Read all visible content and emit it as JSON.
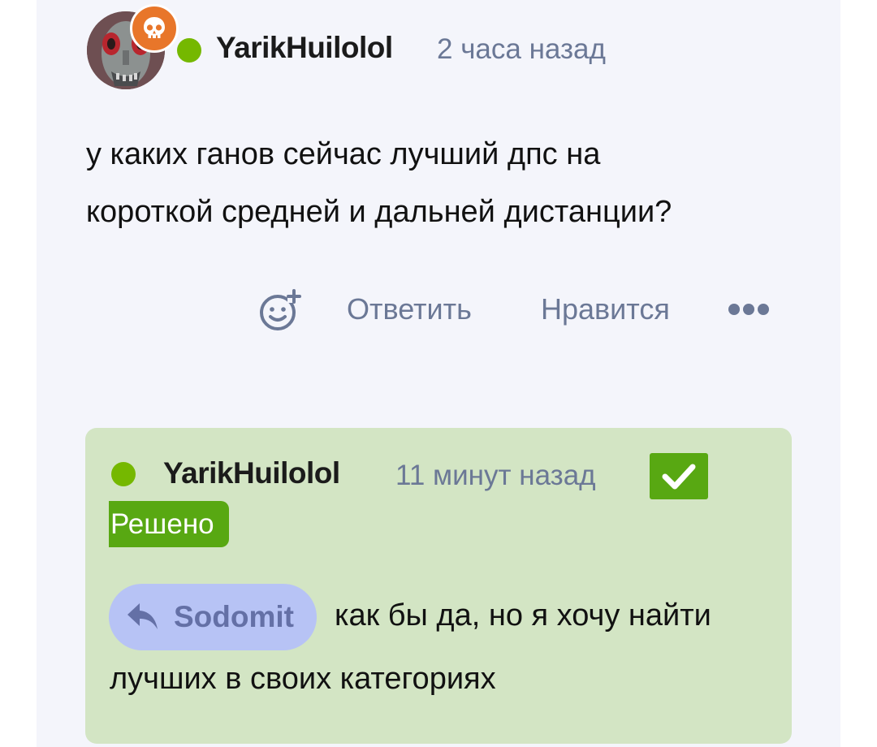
{
  "comment": {
    "author": "YarikHuilolol",
    "time": "2 часа назад",
    "text_line1": "у каких ганов сейчас лучший дпс на",
    "text_line2": "короткой средней и дальней дистанции?",
    "actions": {
      "reply_label": "Ответить",
      "like_label": "Нравится"
    },
    "icons": {
      "badge": "skull-icon",
      "react": "add-reaction-icon",
      "more": "more-dots-icon"
    }
  },
  "reply": {
    "author": "YarikHuilolol",
    "time": "11 минут назад",
    "solved_label": "Решено",
    "mention": "Sodomit",
    "text_line1": "как бы да, но я хочу найти",
    "text_line2": "лучших в своих категориях",
    "icons": {
      "solved": "checkmark-icon",
      "mention": "reply-arrow-icon"
    }
  },
  "colors": {
    "online": "#75b800",
    "solved": "#58a812",
    "reply_background": "#d3e5c4",
    "mention_pill": "#b7c3f5",
    "badge": "#e8762a",
    "muted_text": "#6b7896"
  }
}
